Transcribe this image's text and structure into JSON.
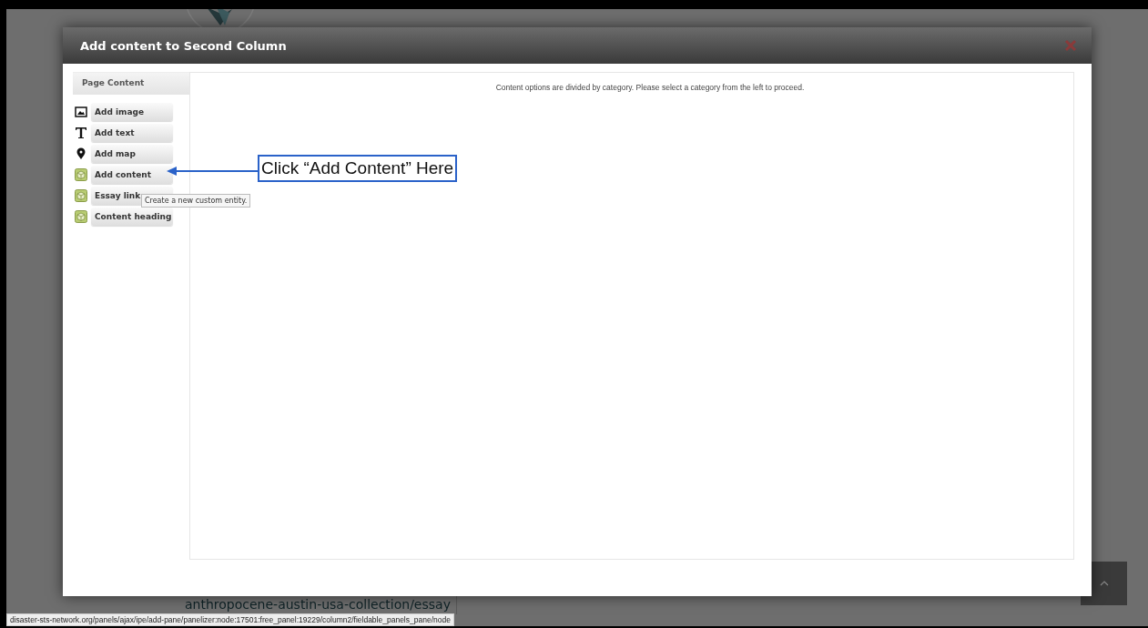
{
  "background": {
    "path_text": "anthropocene-austin-usa-collection/essay"
  },
  "modal": {
    "title": "Add content to Second Column",
    "sidebar": {
      "heading": "Page Content",
      "items": [
        {
          "label": "Add image",
          "kind": "image"
        },
        {
          "label": "Add text",
          "kind": "text"
        },
        {
          "label": "Add map",
          "kind": "map"
        },
        {
          "label": "Add content",
          "kind": "entity"
        },
        {
          "label": "Essay link",
          "kind": "entity"
        },
        {
          "label": "Content heading",
          "kind": "entity"
        }
      ]
    },
    "message": "Content options are divided by category. Please select a category from the left to proceed."
  },
  "tooltip": "Create a new custom entity.",
  "annotation": {
    "text": "Click “Add Content” Here"
  },
  "status_bar": "disaster-sts-network.org/panels/ajax/ipe/add-pane/panelizer:node:17501:free_panel:19229/column2/fieldable_panels_pane/node"
}
